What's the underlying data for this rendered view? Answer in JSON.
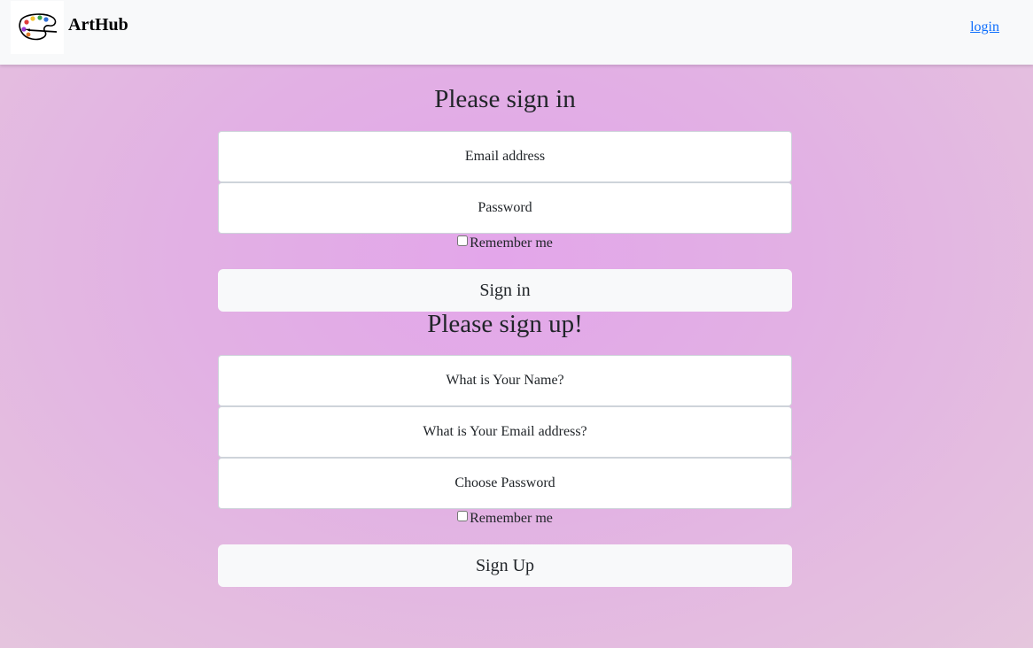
{
  "navbar": {
    "brand": "ArtHub",
    "logo_icon": "palette-icon",
    "login_link": "login"
  },
  "signin": {
    "title": "Please sign in",
    "email_placeholder": "Email address",
    "password_placeholder": "Password",
    "remember_label": "Remember me",
    "submit_label": "Sign in"
  },
  "signup": {
    "title": "Please sign up!",
    "name_placeholder": "What is Your Name?",
    "email_placeholder": "What is Your Email address?",
    "password_placeholder": "Choose Password",
    "remember_label": "Remember me",
    "submit_label": "Sign Up"
  },
  "colors": {
    "navbar_bg": "#f8f9fa",
    "link": "#0d6efd",
    "background_center": "#e3a6ea",
    "background_edge": "#e5c6dd"
  }
}
